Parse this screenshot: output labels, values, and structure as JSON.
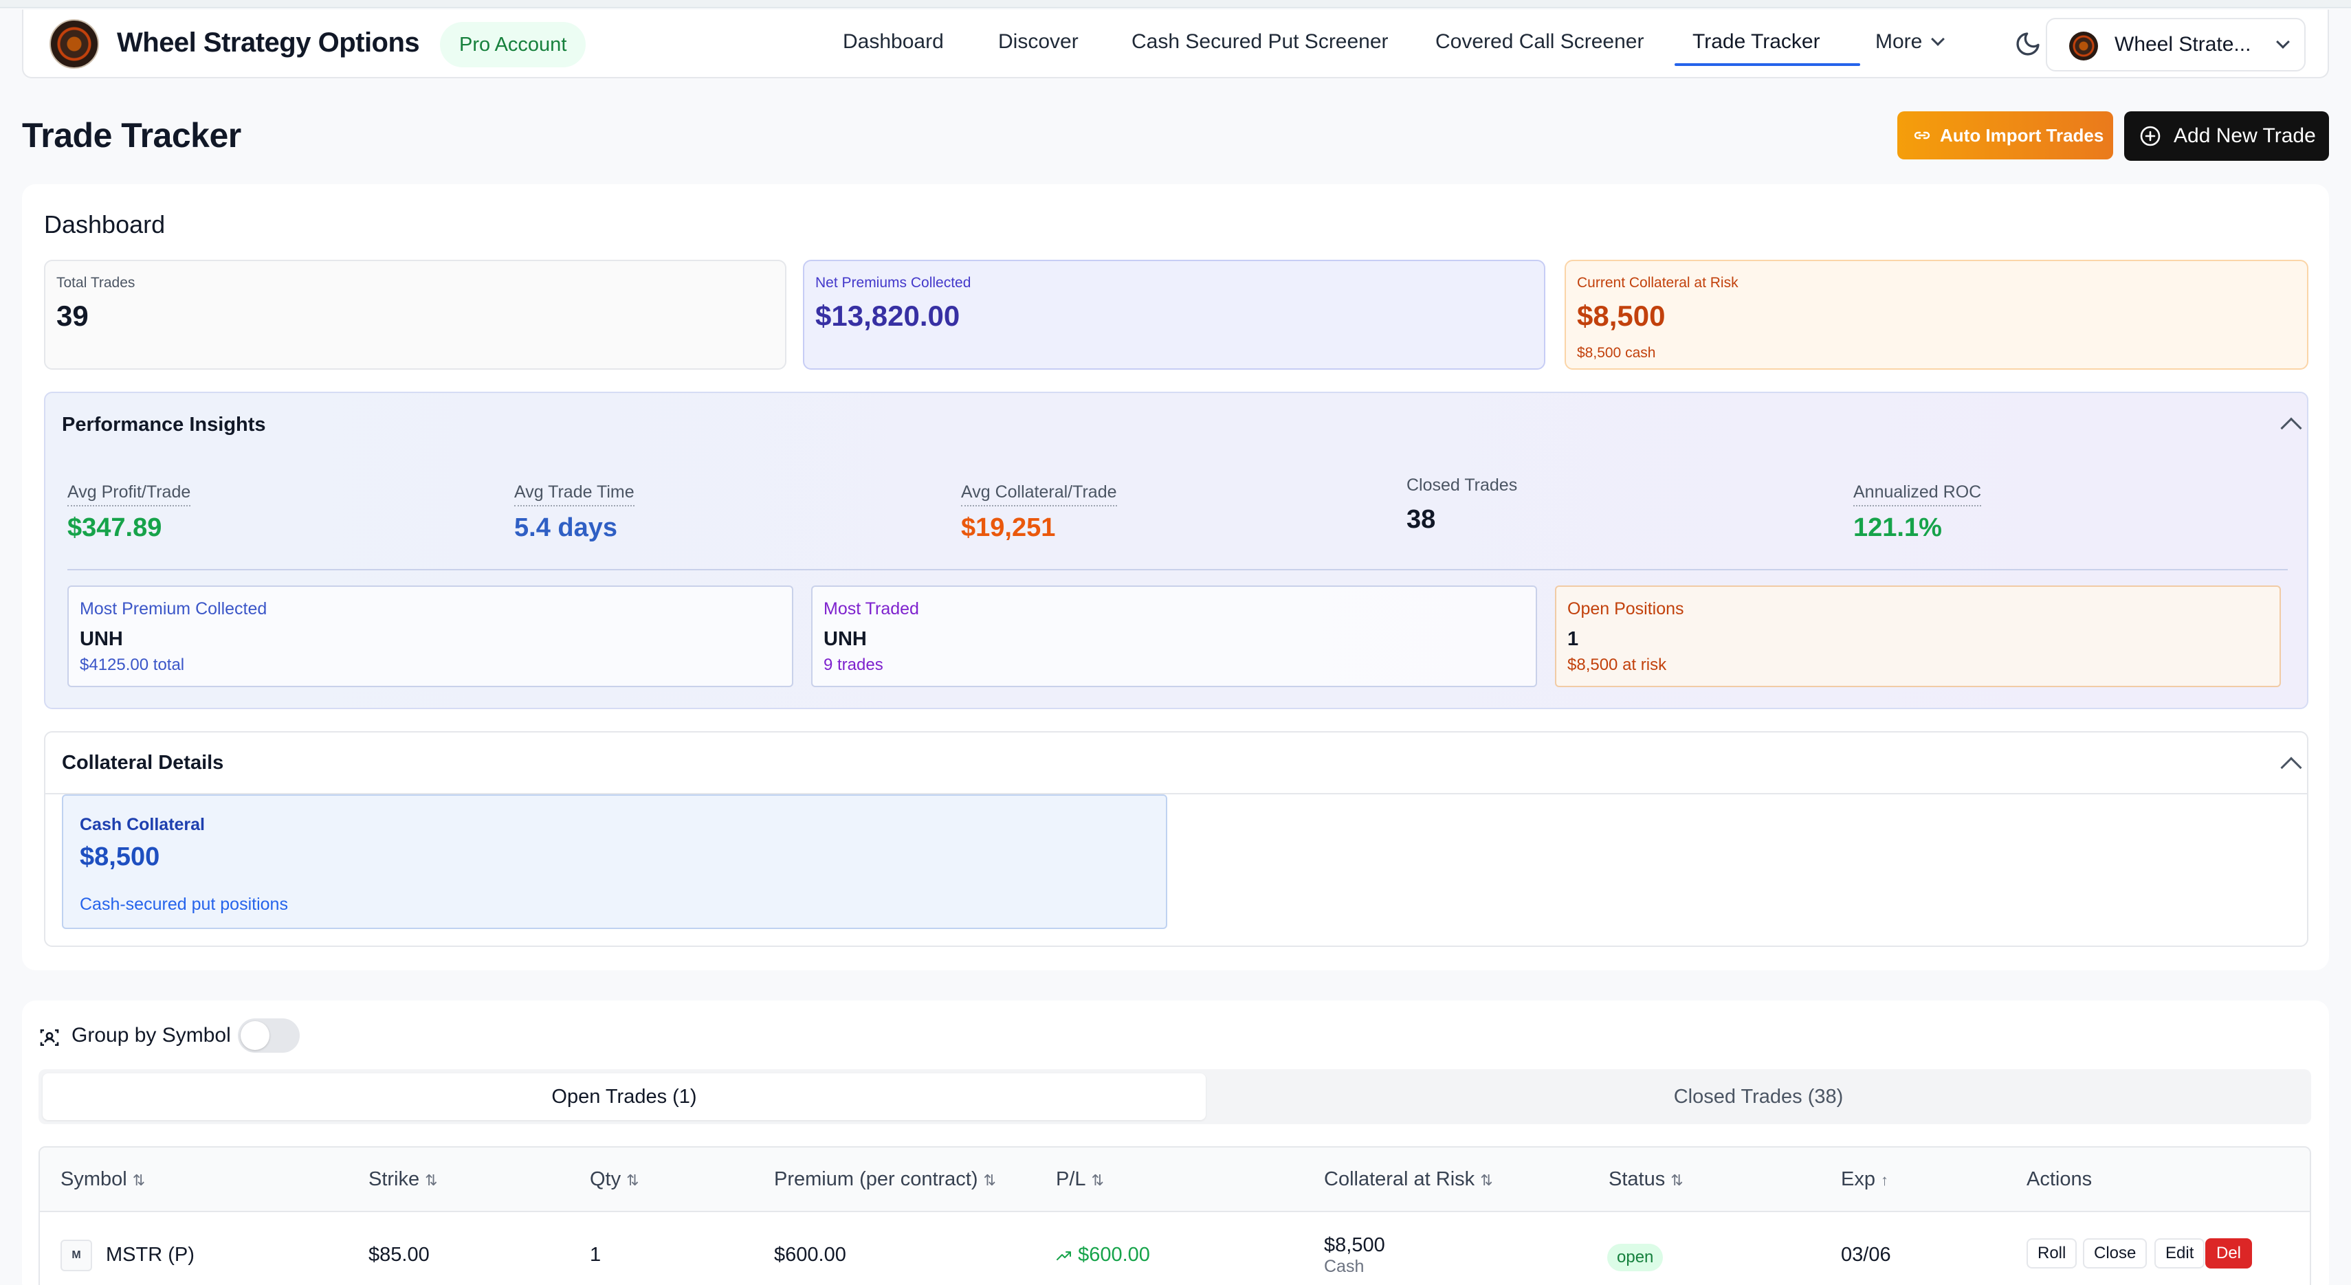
{
  "app": {
    "brand": "Wheel Strategy Options",
    "badge": "Pro Account",
    "account_name": "Wheel Strate..."
  },
  "nav": {
    "items": [
      {
        "label": "Dashboard"
      },
      {
        "label": "Discover"
      },
      {
        "label": "Cash Secured Put Screener"
      },
      {
        "label": "Covered Call Screener"
      },
      {
        "label": "Trade Tracker",
        "active": true
      },
      {
        "label": "More"
      }
    ]
  },
  "header": {
    "title": "Trade Tracker",
    "import_label": "Auto Import Trades",
    "add_label": "Add New Trade"
  },
  "dashboard": {
    "title": "Dashboard",
    "stats": [
      {
        "label": "Total Trades",
        "value": "39"
      },
      {
        "label": "Net Premiums Collected",
        "value": "$13,820.00"
      },
      {
        "label": "Current Collateral at Risk",
        "value": "$8,500",
        "sub": "$8,500 cash"
      }
    ],
    "performance": {
      "title": "Performance Insights",
      "metrics": [
        {
          "label": "Avg Profit/Trade",
          "value": "$347.89"
        },
        {
          "label": "Avg Trade Time",
          "value": "5.4 days"
        },
        {
          "label": "Avg Collateral/Trade",
          "value": "$19,251"
        },
        {
          "label": "Closed Trades",
          "value": "38"
        },
        {
          "label": "Annualized ROC",
          "value": "121.1%"
        }
      ],
      "cards": [
        {
          "label": "Most Premium Collected",
          "value": "UNH",
          "sub": "$4125.00 total"
        },
        {
          "label": "Most Traded",
          "value": "UNH",
          "sub": "9 trades"
        },
        {
          "label": "Open Positions",
          "value": "1",
          "sub": "$8,500 at risk"
        }
      ]
    },
    "collateral": {
      "title": "Collateral Details",
      "cash_label": "Cash Collateral",
      "cash_value": "$8,500",
      "cash_sub": "Cash-secured put positions"
    }
  },
  "trades": {
    "group_label": "Group by Symbol",
    "group_enabled": false,
    "tabs": [
      {
        "label": "Open Trades (1)",
        "active": true
      },
      {
        "label": "Closed Trades (38)",
        "active": false
      }
    ],
    "columns": [
      "Symbol",
      "Strike",
      "Qty",
      "Premium (per contract)",
      "P/L",
      "Collateral at Risk",
      "Status",
      "Exp",
      "Actions"
    ],
    "sort_icons": [
      "⇅",
      "⇅",
      "⇅",
      "⇅",
      "⇅",
      "⇅",
      "⇅",
      "↑"
    ],
    "rows": [
      {
        "symbol_initial": "M",
        "symbol": "MSTR (P)",
        "strike": "$85.00",
        "qty": "1",
        "premium": "$600.00",
        "pl": "$600.00",
        "collateral": "$8,500",
        "collateral_type": "Cash",
        "status": "open",
        "exp": "03/06",
        "actions": [
          "Roll",
          "Close",
          "Edit",
          "Del"
        ]
      }
    ]
  },
  "colors": {
    "accent": "#2563eb",
    "positive": "#16a34a",
    "warning": "#c2410c",
    "danger": "#dc2626"
  }
}
